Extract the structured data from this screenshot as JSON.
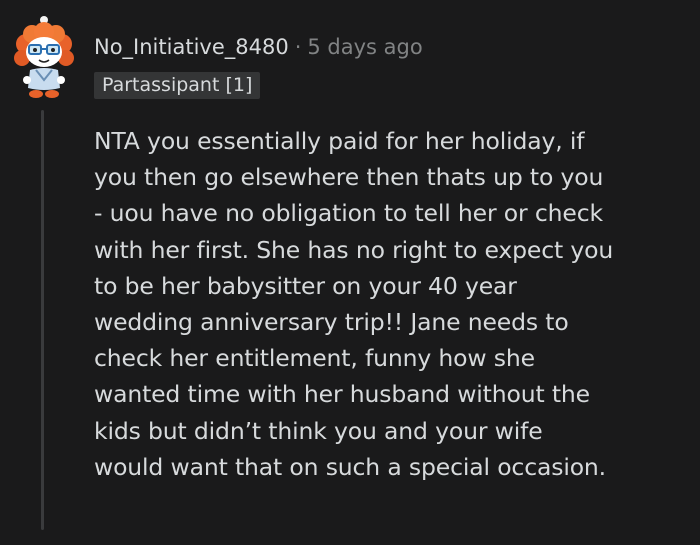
{
  "comment": {
    "author": "No_Initiative_8480",
    "separator": "·",
    "time_ago": "5 days ago",
    "flair": "Partassipant [1]",
    "avatar_icon": "reddit-snoo-avatar-icon",
    "body_lines": [
      "NTA you essentially paid for her holiday, if",
      "you then go elsewhere then thats up to you",
      "- uou have no obligation to tell her or check",
      "with her first. She has no right to expect you",
      "to be her babysitter on your 40 year",
      "wedding anniversary trip!! Jane needs to",
      "check her entitlement, funny how she",
      "wanted time with her husband without the",
      "kids but didn’t think you and your wife",
      "would want that on such a special occasion."
    ]
  },
  "colors": {
    "background": "#1a1a1b",
    "text": "#d7dadc",
    "meta": "#818384",
    "flair_bg": "#343536",
    "thread_line": "#3a3b3d"
  }
}
